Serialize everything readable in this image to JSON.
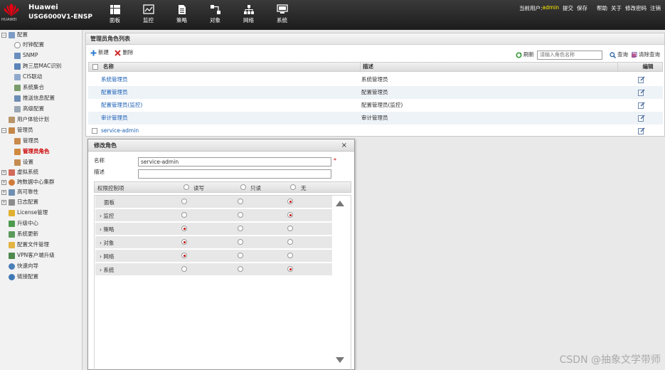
{
  "header": {
    "logo_text": "HUAWEI",
    "brand": "Huawei",
    "model": "USG6000V1-ENSP",
    "nav": [
      {
        "label": "面板",
        "icon": "dashboard-icon"
      },
      {
        "label": "监控",
        "icon": "monitor-chart-icon"
      },
      {
        "label": "策略",
        "icon": "policy-doc-icon"
      },
      {
        "label": "对象",
        "icon": "object-icon"
      },
      {
        "label": "网络",
        "icon": "network-icon"
      },
      {
        "label": "系统",
        "icon": "system-monitor-icon"
      }
    ],
    "current_user_label": "当前用户:",
    "current_user": "admin",
    "links": [
      "提交",
      "保存",
      "帮助",
      "关于",
      "修改密码",
      "注销"
    ]
  },
  "sidebar": {
    "items": [
      {
        "label": "配置",
        "pm": "−"
      },
      {
        "label": "时钟配置"
      },
      {
        "label": "SNMP"
      },
      {
        "label": "跨三层MAC识别"
      },
      {
        "label": "CIS联动"
      },
      {
        "label": "系统集合"
      },
      {
        "label": "推送信息配置"
      },
      {
        "label": "高级配置"
      },
      {
        "label": "用户体验计划"
      },
      {
        "label": "管理员",
        "pm": "−"
      },
      {
        "label": "管理员"
      },
      {
        "label": "管理员角色"
      },
      {
        "label": "设置"
      },
      {
        "label": "虚拟系统",
        "pm": "+"
      },
      {
        "label": "跨数据中心集群",
        "pm": "+"
      },
      {
        "label": "高可靠性",
        "pm": "+"
      },
      {
        "label": "日志配置",
        "pm": "+"
      },
      {
        "label": "License管理"
      },
      {
        "label": "升级中心"
      },
      {
        "label": "系统更新"
      },
      {
        "label": "配置文件管理"
      },
      {
        "label": "VPN客户端升级"
      },
      {
        "label": "快速向导"
      },
      {
        "label": "链接配置"
      }
    ]
  },
  "main": {
    "title": "管理员角色列表",
    "toolbar": {
      "new": "新建",
      "delete": "删除",
      "refresh": "刷新",
      "search_placeholder": "请输入角色名称",
      "query": "查询",
      "clear_query": "清除查询"
    },
    "columns": {
      "name": "名称",
      "desc": "描述",
      "edit": "编辑"
    },
    "rows": [
      {
        "name": "系统管理员",
        "desc": "系统管理员"
      },
      {
        "name": "配置管理员",
        "desc": "配置管理员"
      },
      {
        "name": "配置管理员(监控)",
        "desc": "配置管理员(监控)"
      },
      {
        "name": "审计管理员",
        "desc": "审计管理员"
      },
      {
        "name": "service-admin",
        "desc": ""
      }
    ]
  },
  "dialog": {
    "title": "修改角色",
    "close": "×",
    "name_label": "名称",
    "name_value": "service-admin",
    "required_mark": "*",
    "desc_label": "描述",
    "desc_value": "",
    "perm_header": {
      "item": "权限控制项",
      "rw": "读写",
      "ro": "只读",
      "none": "无"
    },
    "perms": [
      {
        "label": "面板",
        "value": "none"
      },
      {
        "label": "监控",
        "value": "none"
      },
      {
        "label": "策略",
        "value": "rw"
      },
      {
        "label": "对象",
        "value": "rw"
      },
      {
        "label": "网络",
        "value": "rw"
      },
      {
        "label": "系统",
        "value": "none"
      }
    ]
  },
  "watermark": "CSDN @抽象文学带师"
}
